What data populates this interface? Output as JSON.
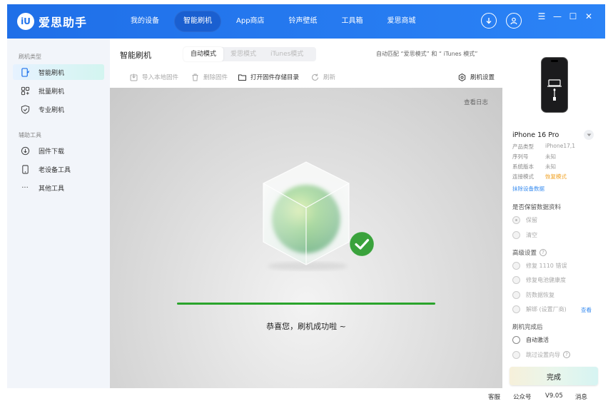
{
  "app": {
    "logo_badge": "iU",
    "name": "爱思助手"
  },
  "nav": [
    {
      "label": "我的设备",
      "active": false
    },
    {
      "label": "智能刷机",
      "active": true
    },
    {
      "label": "App商店",
      "active": false
    },
    {
      "label": "铃声壁纸",
      "active": false
    },
    {
      "label": "工具箱",
      "active": false
    },
    {
      "label": "爱思商城",
      "active": false
    }
  ],
  "window_controls": {
    "menu": "☰",
    "minimize": "—",
    "maximize": "☐",
    "close": "✕"
  },
  "sidebar": {
    "section1_title": "刷机类型",
    "items1": [
      {
        "label": "智能刷机",
        "icon": "smart-flash-icon",
        "active": true
      },
      {
        "label": "批量刷机",
        "icon": "batch-flash-icon",
        "active": false
      },
      {
        "label": "专业刷机",
        "icon": "pro-flash-icon",
        "active": false
      }
    ],
    "section2_title": "辅助工具",
    "items2": [
      {
        "label": "固件下载",
        "icon": "firmware-download-icon"
      },
      {
        "label": "老设备工具",
        "icon": "old-device-icon"
      },
      {
        "label": "其他工具",
        "icon": "more-dots-icon",
        "glyph": "···"
      }
    ]
  },
  "main": {
    "title": "智能刷机",
    "mode_tabs": [
      {
        "label": "自动模式",
        "active": true
      },
      {
        "label": "爱思模式",
        "active": false
      },
      {
        "label": "iTunes模式",
        "active": false
      }
    ],
    "auto_note": "自动匹配 “爱思模式” 和 “ iTunes 模式”",
    "toolbar": {
      "import": "导入本地固件",
      "delete": "删除固件",
      "open_dir": "打开固件存储目录",
      "refresh": "刷新",
      "settings": "刷机设置"
    },
    "view_log": "查看日志",
    "progress": 1.0,
    "success_text": "恭喜您，刷机成功啦 ~"
  },
  "device": {
    "name": "iPhone 16 Pro",
    "specs": [
      {
        "k": "产品类型",
        "v": "iPhone17,1",
        "highlight": false
      },
      {
        "k": "序列号",
        "v": "未知",
        "highlight": false
      },
      {
        "k": "系统版本",
        "v": "未知",
        "highlight": false
      },
      {
        "k": "连接模式",
        "v": "恢复模式",
        "highlight": true
      }
    ],
    "exit_link": "抹除设备数据"
  },
  "options": {
    "keep_data_label": "是否保留数据资料",
    "keep": "保留",
    "clear": "清空",
    "advanced_label": "高级设置",
    "fix_1110": "修复 1110 错误",
    "fix_battery": "修复电池健康度",
    "anti_recover": "防数据恢复",
    "unbind": "解绑 (设置厂商)",
    "view_link": "查看",
    "after_flash_label": "刷机完成后",
    "auto_activate": "自动激活",
    "skip_setup": "跳过设置向导",
    "done": "完成"
  },
  "status": {
    "service": "客服",
    "wechat": "公众号",
    "version": "V9.05",
    "message": "消息"
  },
  "colors": {
    "primary": "#2173ec",
    "progress": "#2aa42c",
    "success": "#3aa23c",
    "warning": "#f0a020",
    "link": "#3b8ef0"
  }
}
